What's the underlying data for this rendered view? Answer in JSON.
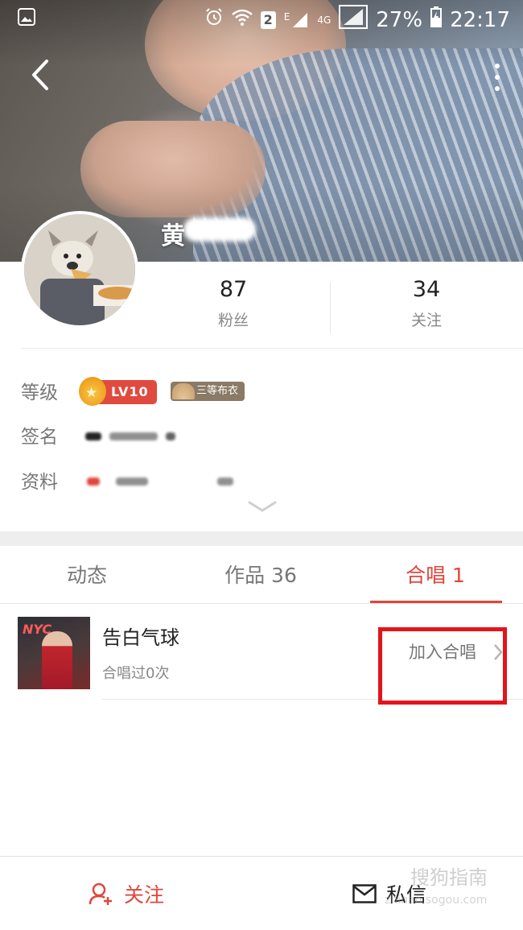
{
  "status_bar": {
    "battery": "27%",
    "time": "22:17",
    "network_4g": "4G",
    "network_e": "E",
    "sim_slot": "2"
  },
  "profile": {
    "username": "黄",
    "stats": [
      {
        "value": "87",
        "label": "粉丝"
      },
      {
        "value": "34",
        "label": "关注"
      }
    ],
    "info": {
      "level_label": "等级",
      "level_badge": "LV10",
      "rank_badge": "三等布衣",
      "signature_label": "签名",
      "signature_value": "",
      "details_label": "资料",
      "details_value": ""
    }
  },
  "tabs": [
    {
      "label": "动态",
      "active": false
    },
    {
      "label": "作品 36",
      "active": false
    },
    {
      "label": "合唱 1",
      "active": true
    }
  ],
  "chorus_items": [
    {
      "title": "告白气球",
      "subtitle": "合唱过0次",
      "action": "加入合唱",
      "thumb_text": "NYC"
    }
  ],
  "bottom_bar": {
    "follow": "关注",
    "message": "私信"
  },
  "watermark": {
    "text": "搜狗指南",
    "sub": "zhinan.sogou.com"
  },
  "colors": {
    "accent": "#e0463c",
    "highlight_box": "#e3141c",
    "level_badge": "#e04a3f",
    "rank_badge": "#8a7a66"
  }
}
